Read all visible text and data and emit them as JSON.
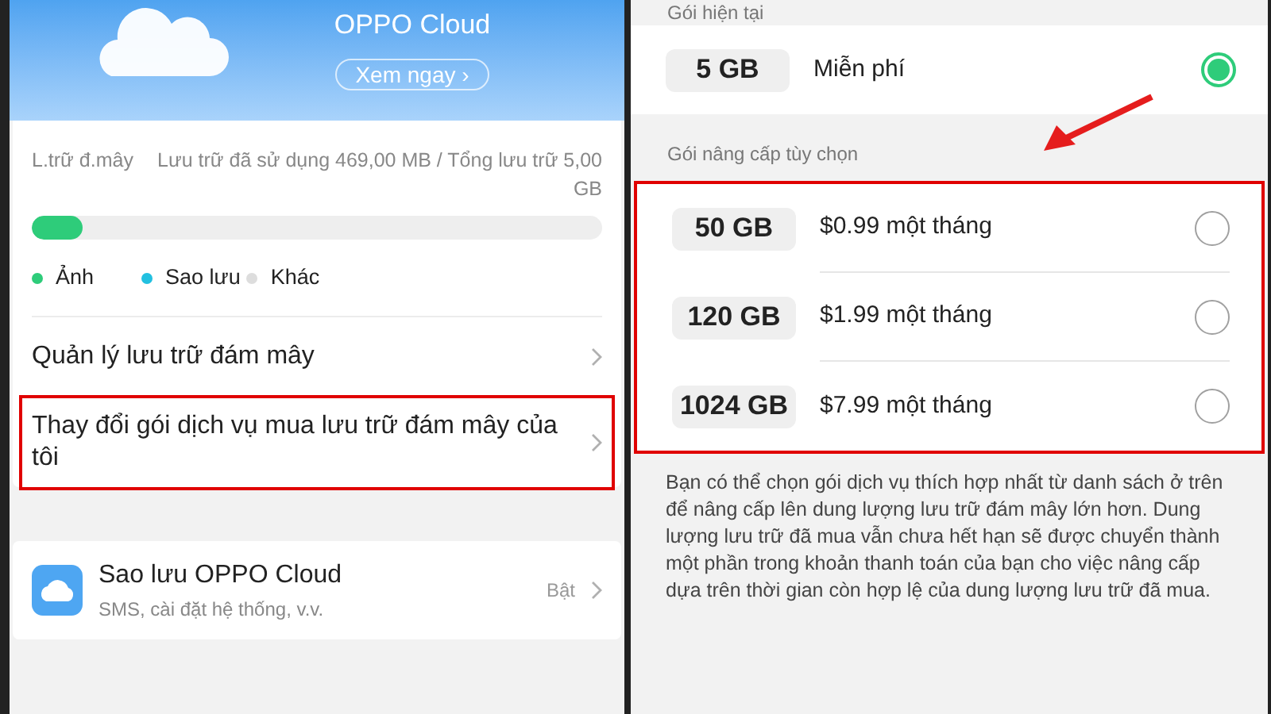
{
  "left": {
    "banner": {
      "title": "OPPO Cloud",
      "button": "Xem ngay ›"
    },
    "storage": {
      "label": "L.trữ đ.mây",
      "value": "Lưu trữ đã sử dụng 469,00 MB / Tổng lưu trữ 5,00 GB",
      "level": 0.09,
      "legend": [
        {
          "label": "Ảnh",
          "color": "#2ecc7a"
        },
        {
          "label": "Sao lưu",
          "color": "#22c0e0"
        },
        {
          "label": "Khác",
          "color": "#dddddd"
        }
      ]
    },
    "items": [
      {
        "label": "Quản lý lưu trữ đám mây",
        "highlighted": false
      },
      {
        "label": "Thay đổi gói dịch vụ mua lưu trữ đám mây của tôi",
        "highlighted": true
      }
    ],
    "backup": {
      "title": "Sao lưu OPPO Cloud",
      "subtitle": "SMS, cài đặt hệ thống, v.v.",
      "status": "Bật"
    }
  },
  "right": {
    "current_header": "Gói hiện tại",
    "current": {
      "size": "5 GB",
      "price": "Miễn phí",
      "selected": true
    },
    "upgrade_header": "Gói nâng cấp tùy chọn",
    "upgrade_highlighted": true,
    "plans": [
      {
        "size": "50 GB",
        "price": "$0.99 một tháng",
        "selected": false
      },
      {
        "size": "120 GB",
        "price": "$1.99 một tháng",
        "selected": false
      },
      {
        "size": "1024 GB",
        "price": "$7.99 một tháng",
        "selected": false
      }
    ],
    "note": "Bạn có thể chọn gói dịch vụ thích hợp nhất từ danh sách ở trên để nâng cấp lên dung lượng lưu trữ đám mây lớn hơn. Dung lượng lưu trữ đã mua vẫn chưa hết hạn sẽ được chuyển thành một phần trong khoản thanh toán của bạn cho việc nâng cấp dựa trên thời gian còn hợp lệ của dung lượng lưu trữ đã mua."
  }
}
